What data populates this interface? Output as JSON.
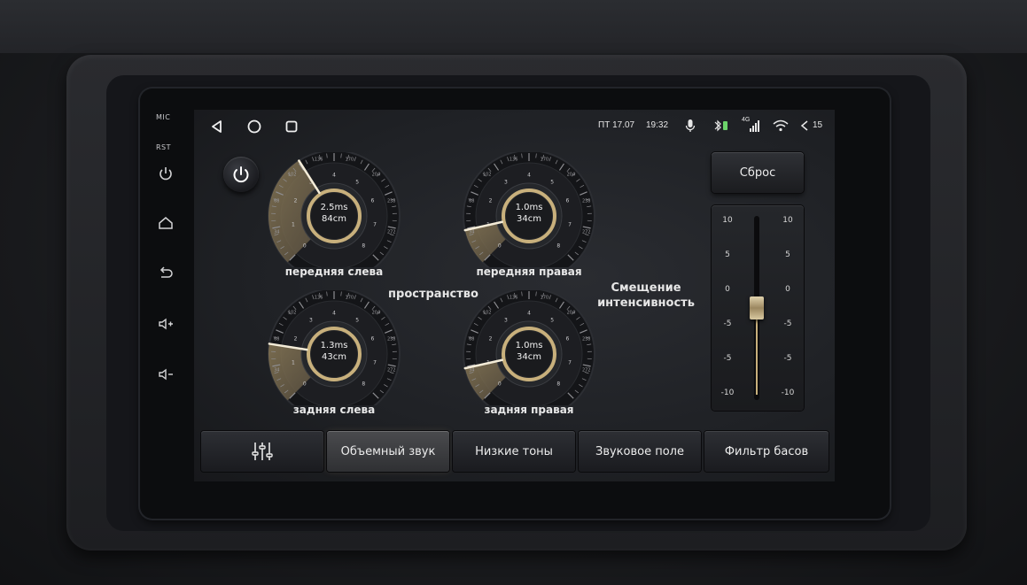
{
  "device": {
    "mic_label": "MIC",
    "rst_label": "RST",
    "side_buttons": [
      "power-icon",
      "home-icon",
      "back-icon",
      "volume-up-icon",
      "volume-down-icon"
    ]
  },
  "statusbar": {
    "nav_icons": [
      "back-triangle-icon",
      "home-circle-icon",
      "recents-square-icon"
    ],
    "date": "ПТ 17.07",
    "time": "19:32",
    "network": "4G",
    "volume": "15",
    "icons": [
      "mic-icon",
      "bluetooth-icon",
      "signal-icon",
      "wifi-icon",
      "volume-icon"
    ]
  },
  "colors": {
    "accent_gold": "#c8b07c",
    "background": "#1f2125",
    "text": "#ececec"
  },
  "gauges": [
    {
      "id": "front-left",
      "title": "передняя слева",
      "line1": "2.5ms",
      "line2": "84cm",
      "level": 0.38
    },
    {
      "id": "front-right",
      "title": "передняя правая",
      "line1": "1.0ms",
      "line2": "34cm",
      "level": 0.12
    },
    {
      "id": "rear-left",
      "title": "задняя слева",
      "line1": "1.3ms",
      "line2": "43cm",
      "level": 0.2
    },
    {
      "id": "rear-right",
      "title": "задняя правая",
      "line1": "1.0ms",
      "line2": "34cm",
      "level": 0.12
    }
  ],
  "gauge_scale": {
    "inner": [
      "0",
      "1",
      "2",
      "3",
      "4",
      "5",
      "6",
      "7",
      "8"
    ],
    "outer": [
      "34",
      "68",
      "102",
      "136",
      "170",
      "204",
      "238",
      "272"
    ]
  },
  "labels": {
    "space": "пространство",
    "intensity_line1": "Смещение",
    "intensity_line2": "интенсивность"
  },
  "reset_button": "Сброс",
  "fader": {
    "ticks": [
      "10",
      "5",
      "0",
      "-5",
      "-5",
      "-10"
    ],
    "value": 0
  },
  "tabs": [
    {
      "label": "",
      "icon": "equalizer-icon",
      "active": false
    },
    {
      "label": "Объемный звук",
      "active": true
    },
    {
      "label": "Низкие тоны",
      "active": false
    },
    {
      "label": "Звуковое поле",
      "active": false
    },
    {
      "label": "Фильтр басов",
      "active": false
    }
  ]
}
